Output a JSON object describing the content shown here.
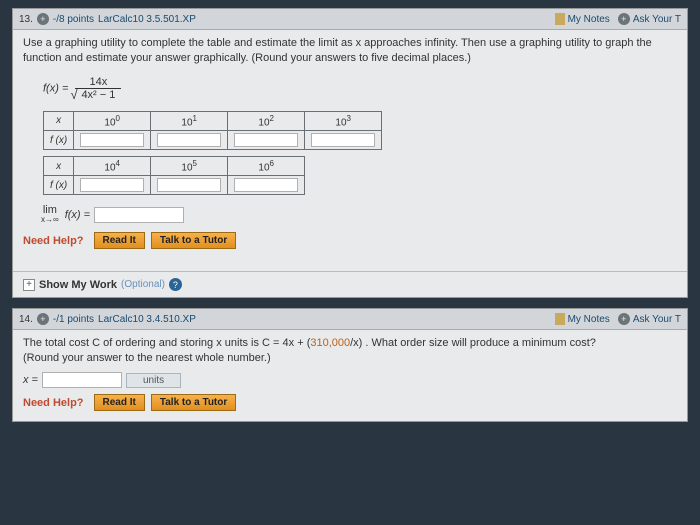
{
  "q1": {
    "number": "13.",
    "points": "-/8 points",
    "ref": "LarCalc10 3.5.501.XP",
    "myNotes": "My Notes",
    "askTeacher": "Ask Your T",
    "prompt": "Use a graphing utility to complete the table and estimate the limit as x approaches infinity. Then use a graphing utility to graph the function and estimate your answer graphically. (Round your answers to five decimal places.)",
    "function_lhs": "f(x) =",
    "function_num": "14x",
    "function_den_inner": "4x² − 1",
    "table1": {
      "rowX": "x",
      "rowF": "f (x)",
      "cols": [
        "10⁰",
        "10¹",
        "10²",
        "10³"
      ]
    },
    "table2": {
      "rowX": "x",
      "rowF": "f (x)",
      "cols": [
        "10⁴",
        "10⁵",
        "10⁶"
      ]
    },
    "lim_top": "lim",
    "lim_bot": "x→∞",
    "lim_fx": "f(x) =",
    "needHelp": "Need Help?",
    "readIt": "Read It",
    "talkTutor": "Talk to a Tutor",
    "showMyWork": "Show My Work",
    "optional": "(Optional)"
  },
  "q2": {
    "number": "14.",
    "points": "-/1 points",
    "ref": "LarCalc10 3.4.510.XP",
    "myNotes": "My Notes",
    "askTeacher": "Ask Your T",
    "prompt_a": "The total cost C of ordering and storing x units is C = 4x + (",
    "prompt_orange": "310,000",
    "prompt_b": "/x) . What order size will produce a minimum cost?",
    "prompt_c": "(Round your answer to the nearest whole number.)",
    "xlab": "x =",
    "units": "units",
    "needHelp": "Need Help?",
    "readIt": "Read It",
    "talkTutor": "Talk to a Tutor"
  }
}
